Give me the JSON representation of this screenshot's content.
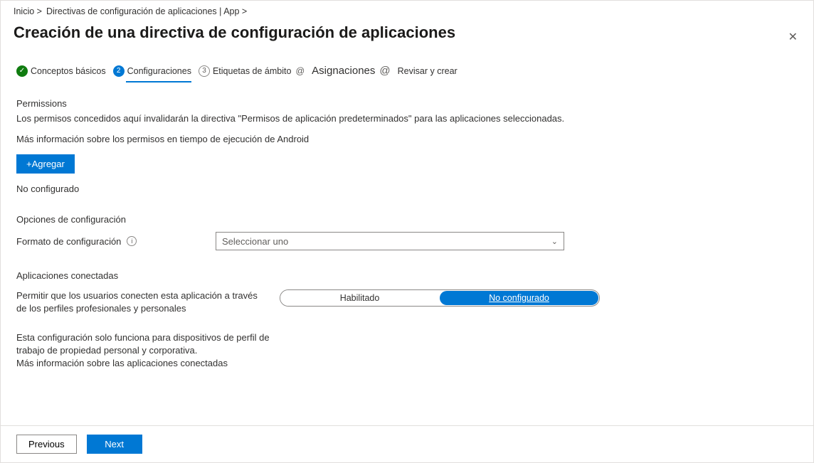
{
  "breadcrumb": {
    "part1": "Inicio >",
    "part2": "Directivas de configuración de aplicaciones | App >"
  },
  "title": "Creación de una directiva de configuración de aplicaciones",
  "tabs": {
    "step1": {
      "badge": "✓",
      "label": "Conceptos básicos"
    },
    "step2": {
      "badge": "2",
      "label": "Configuraciones"
    },
    "step3": {
      "badge": "3",
      "label": "Etiquetas de ámbito",
      "suffix": "@"
    },
    "step4": {
      "label": "Asignaciones",
      "suffix": "@"
    },
    "step5": {
      "label": "Revisar y crear"
    }
  },
  "permissions": {
    "heading": "Permissions",
    "desc": "Los permisos concedidos aquí invalidarán la directiva \"Permisos de aplicación predeterminados\" para las aplicaciones seleccionadas.",
    "more": "Más información sobre los permisos en tiempo de ejecución de Android",
    "add_label": "+Agregar",
    "status": "No configurado"
  },
  "config": {
    "heading": "Opciones de configuración",
    "format_label": "Formato de configuración",
    "select_placeholder": "Seleccionar uno"
  },
  "connected": {
    "heading": "Aplicaciones conectadas",
    "row_label": "Permitir que los usuarios conecten esta aplicación a través de los perfiles profesionales y personales",
    "opt_enabled": "Habilitado",
    "opt_notconfigured": "No configurado",
    "help1": "Esta configuración solo funciona para dispositivos de perfil de trabajo de propiedad personal y corporativa.",
    "help2": "Más información sobre las aplicaciones conectadas"
  },
  "footer": {
    "previous": "Previous",
    "next": "Next"
  }
}
